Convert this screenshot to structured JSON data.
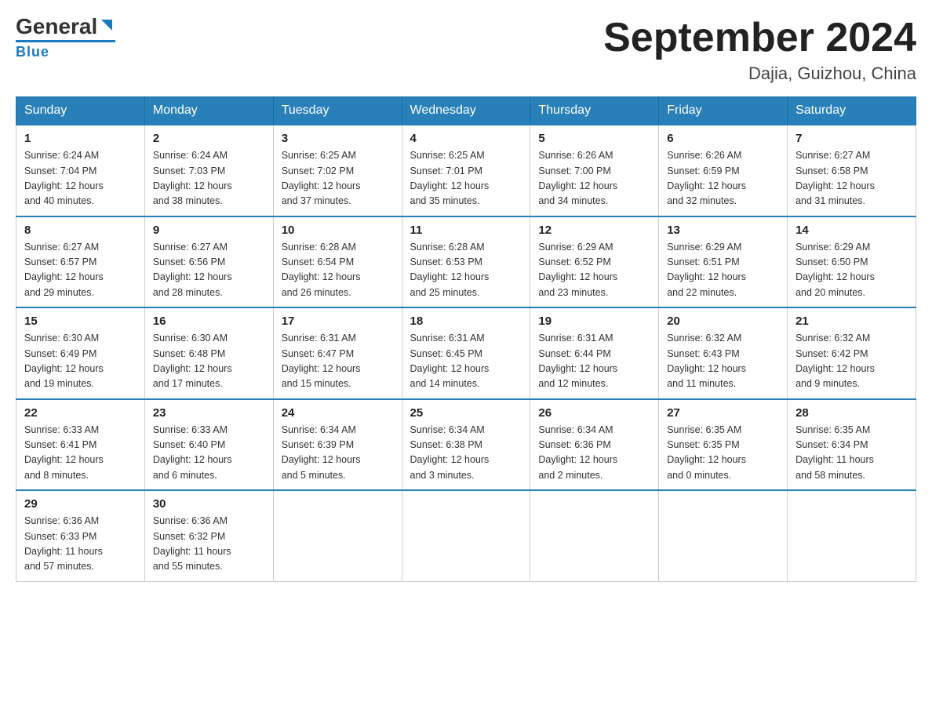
{
  "header": {
    "logo_general": "General",
    "logo_blue": "Blue",
    "month_title": "September 2024",
    "location": "Dajia, Guizhou, China"
  },
  "days_of_week": [
    "Sunday",
    "Monday",
    "Tuesday",
    "Wednesday",
    "Thursday",
    "Friday",
    "Saturday"
  ],
  "weeks": [
    [
      {
        "day": "1",
        "sunrise": "6:24 AM",
        "sunset": "7:04 PM",
        "daylight": "12 hours and 40 minutes."
      },
      {
        "day": "2",
        "sunrise": "6:24 AM",
        "sunset": "7:03 PM",
        "daylight": "12 hours and 38 minutes."
      },
      {
        "day": "3",
        "sunrise": "6:25 AM",
        "sunset": "7:02 PM",
        "daylight": "12 hours and 37 minutes."
      },
      {
        "day": "4",
        "sunrise": "6:25 AM",
        "sunset": "7:01 PM",
        "daylight": "12 hours and 35 minutes."
      },
      {
        "day": "5",
        "sunrise": "6:26 AM",
        "sunset": "7:00 PM",
        "daylight": "12 hours and 34 minutes."
      },
      {
        "day": "6",
        "sunrise": "6:26 AM",
        "sunset": "6:59 PM",
        "daylight": "12 hours and 32 minutes."
      },
      {
        "day": "7",
        "sunrise": "6:27 AM",
        "sunset": "6:58 PM",
        "daylight": "12 hours and 31 minutes."
      }
    ],
    [
      {
        "day": "8",
        "sunrise": "6:27 AM",
        "sunset": "6:57 PM",
        "daylight": "12 hours and 29 minutes."
      },
      {
        "day": "9",
        "sunrise": "6:27 AM",
        "sunset": "6:56 PM",
        "daylight": "12 hours and 28 minutes."
      },
      {
        "day": "10",
        "sunrise": "6:28 AM",
        "sunset": "6:54 PM",
        "daylight": "12 hours and 26 minutes."
      },
      {
        "day": "11",
        "sunrise": "6:28 AM",
        "sunset": "6:53 PM",
        "daylight": "12 hours and 25 minutes."
      },
      {
        "day": "12",
        "sunrise": "6:29 AM",
        "sunset": "6:52 PM",
        "daylight": "12 hours and 23 minutes."
      },
      {
        "day": "13",
        "sunrise": "6:29 AM",
        "sunset": "6:51 PM",
        "daylight": "12 hours and 22 minutes."
      },
      {
        "day": "14",
        "sunrise": "6:29 AM",
        "sunset": "6:50 PM",
        "daylight": "12 hours and 20 minutes."
      }
    ],
    [
      {
        "day": "15",
        "sunrise": "6:30 AM",
        "sunset": "6:49 PM",
        "daylight": "12 hours and 19 minutes."
      },
      {
        "day": "16",
        "sunrise": "6:30 AM",
        "sunset": "6:48 PM",
        "daylight": "12 hours and 17 minutes."
      },
      {
        "day": "17",
        "sunrise": "6:31 AM",
        "sunset": "6:47 PM",
        "daylight": "12 hours and 15 minutes."
      },
      {
        "day": "18",
        "sunrise": "6:31 AM",
        "sunset": "6:45 PM",
        "daylight": "12 hours and 14 minutes."
      },
      {
        "day": "19",
        "sunrise": "6:31 AM",
        "sunset": "6:44 PM",
        "daylight": "12 hours and 12 minutes."
      },
      {
        "day": "20",
        "sunrise": "6:32 AM",
        "sunset": "6:43 PM",
        "daylight": "12 hours and 11 minutes."
      },
      {
        "day": "21",
        "sunrise": "6:32 AM",
        "sunset": "6:42 PM",
        "daylight": "12 hours and 9 minutes."
      }
    ],
    [
      {
        "day": "22",
        "sunrise": "6:33 AM",
        "sunset": "6:41 PM",
        "daylight": "12 hours and 8 minutes."
      },
      {
        "day": "23",
        "sunrise": "6:33 AM",
        "sunset": "6:40 PM",
        "daylight": "12 hours and 6 minutes."
      },
      {
        "day": "24",
        "sunrise": "6:34 AM",
        "sunset": "6:39 PM",
        "daylight": "12 hours and 5 minutes."
      },
      {
        "day": "25",
        "sunrise": "6:34 AM",
        "sunset": "6:38 PM",
        "daylight": "12 hours and 3 minutes."
      },
      {
        "day": "26",
        "sunrise": "6:34 AM",
        "sunset": "6:36 PM",
        "daylight": "12 hours and 2 minutes."
      },
      {
        "day": "27",
        "sunrise": "6:35 AM",
        "sunset": "6:35 PM",
        "daylight": "12 hours and 0 minutes."
      },
      {
        "day": "28",
        "sunrise": "6:35 AM",
        "sunset": "6:34 PM",
        "daylight": "11 hours and 58 minutes."
      }
    ],
    [
      {
        "day": "29",
        "sunrise": "6:36 AM",
        "sunset": "6:33 PM",
        "daylight": "11 hours and 57 minutes."
      },
      {
        "day": "30",
        "sunrise": "6:36 AM",
        "sunset": "6:32 PM",
        "daylight": "11 hours and 55 minutes."
      },
      null,
      null,
      null,
      null,
      null
    ]
  ],
  "labels": {
    "sunrise": "Sunrise:",
    "sunset": "Sunset:",
    "daylight": "Daylight:"
  }
}
